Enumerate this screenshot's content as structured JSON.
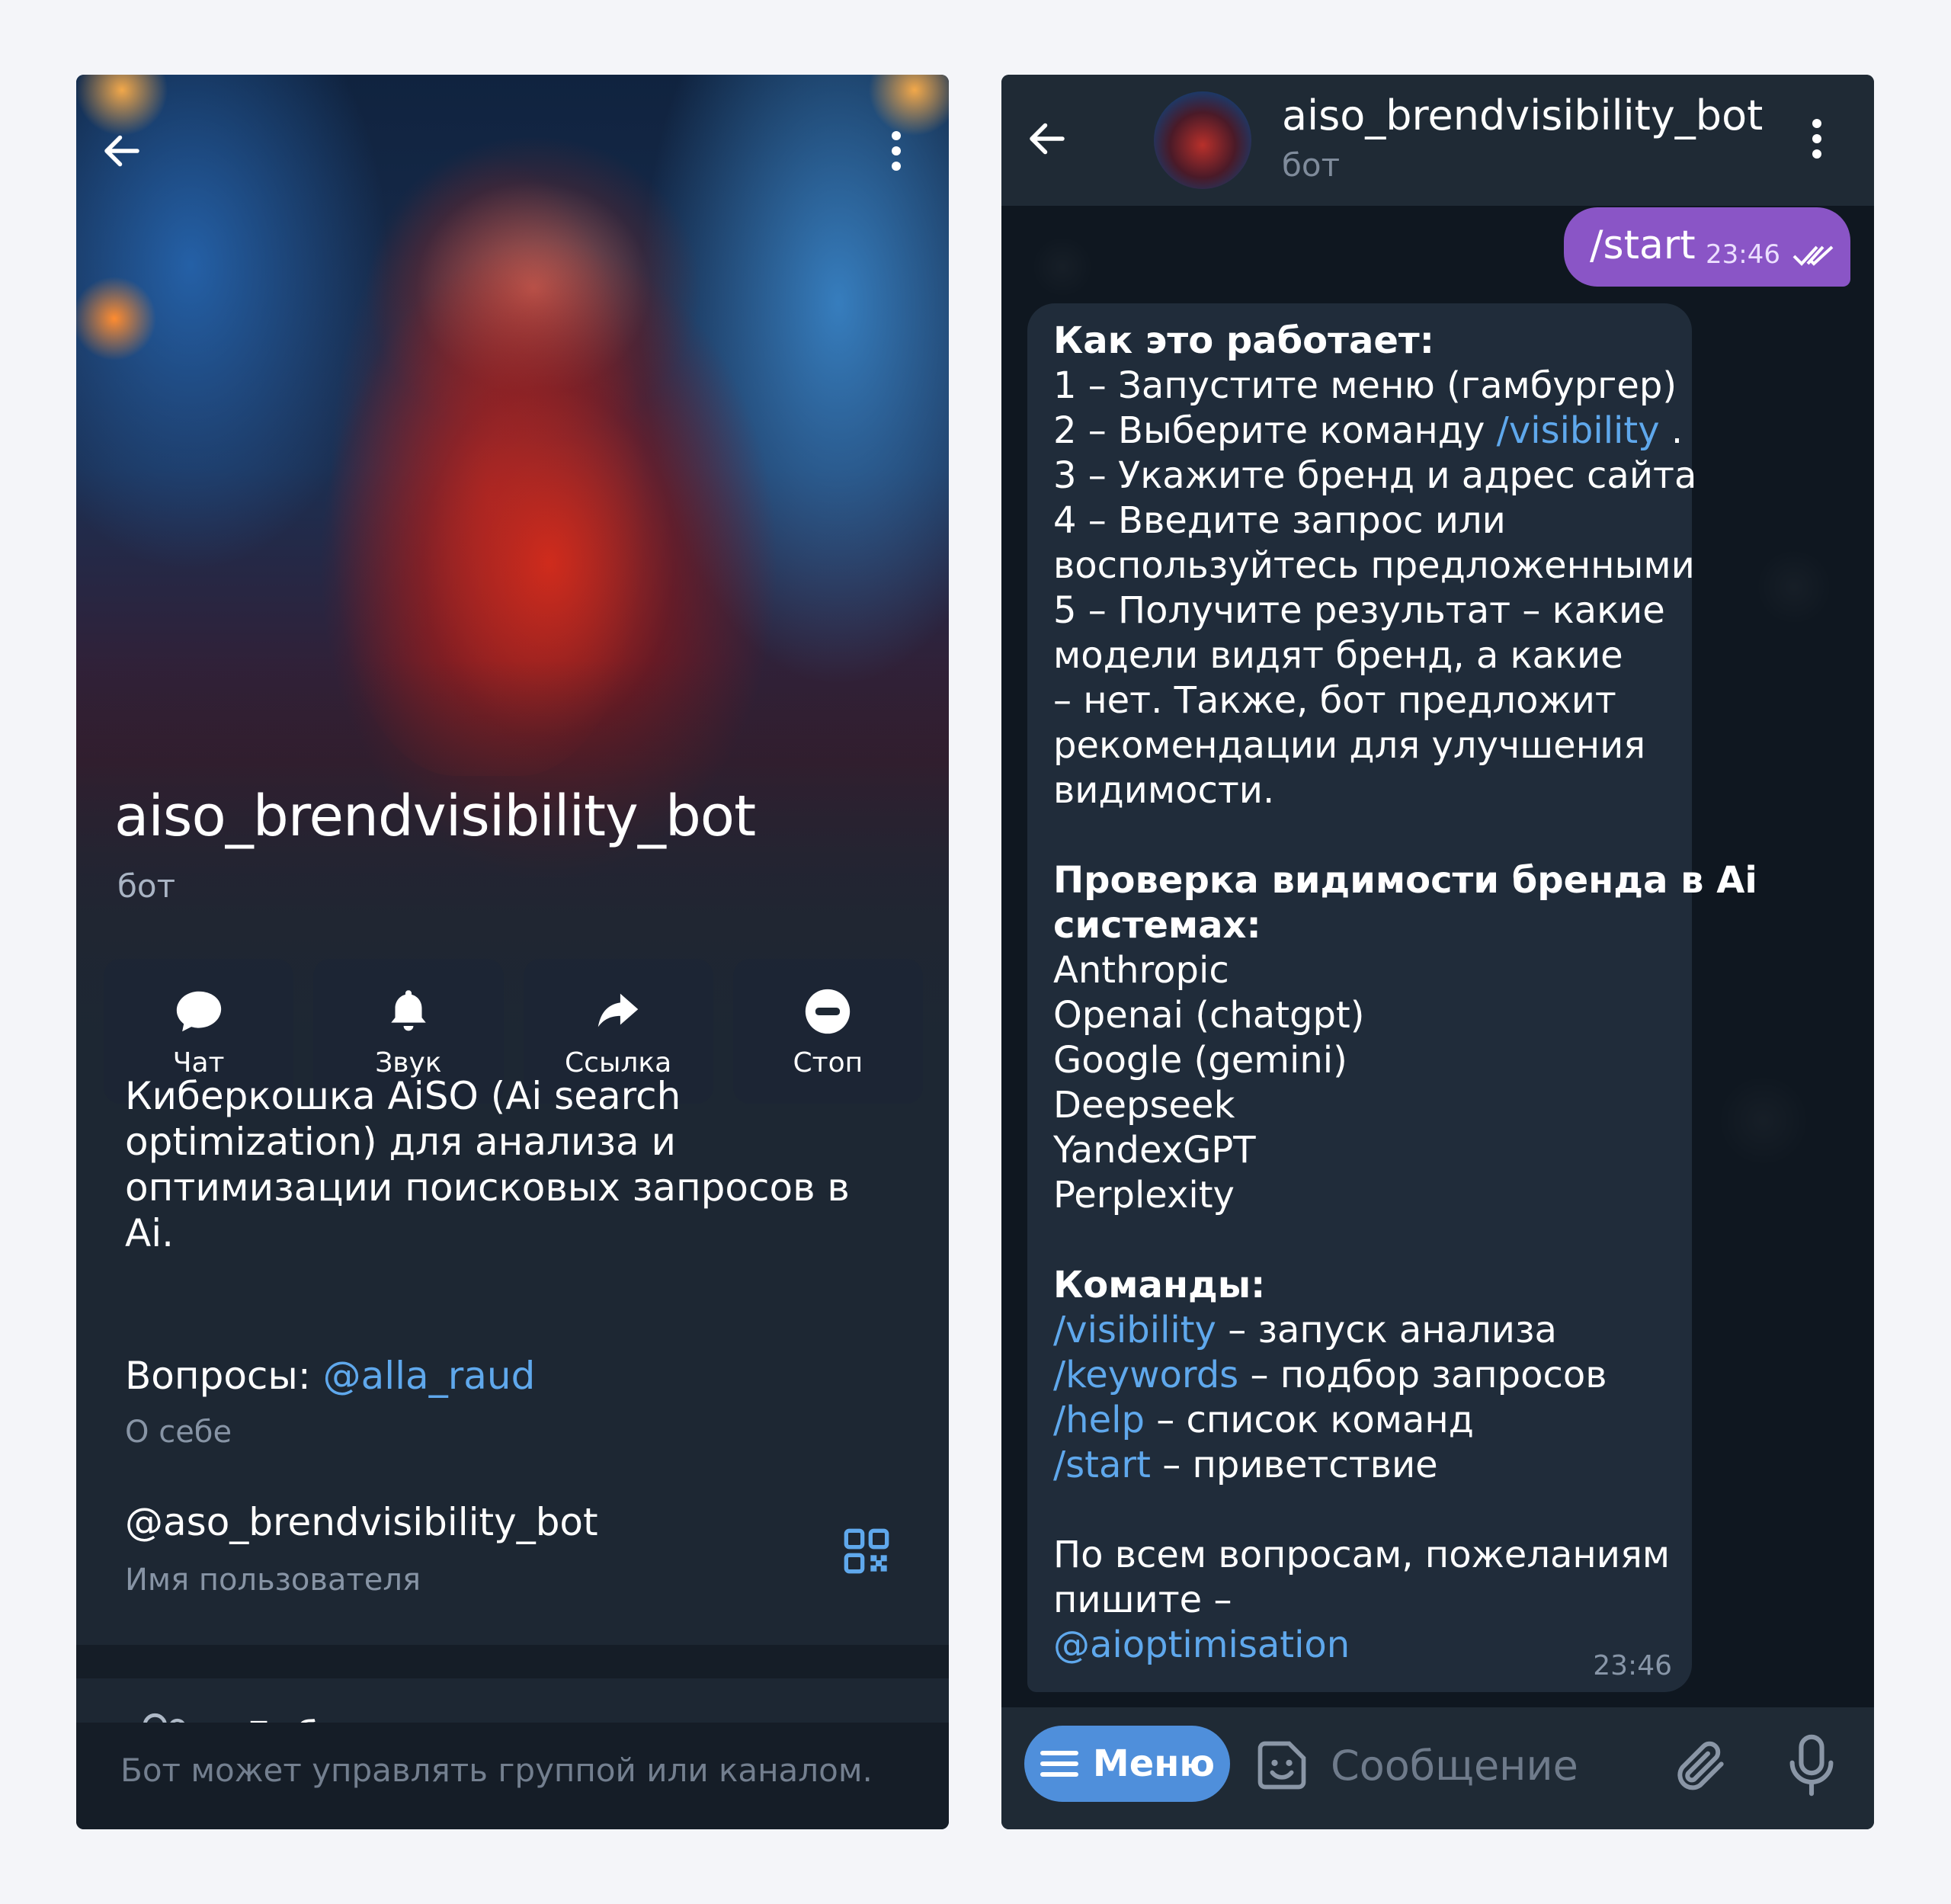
{
  "profile": {
    "name": "aiso_brendvisibility_bot",
    "subtitle": "бот",
    "actions": [
      {
        "label": "Чат",
        "icon": "chat-bubble-icon"
      },
      {
        "label": "Звук",
        "icon": "bell-icon"
      },
      {
        "label": "Ссылка",
        "icon": "share-arrow-icon"
      },
      {
        "label": "Стоп",
        "icon": "stop-icon"
      }
    ],
    "description": "Киберкошка AiSO (Ai search optimization) для анализа и оптимизации поисковых запросов в Ai.",
    "questions_prefix": "Вопросы: ",
    "questions_link": "@alla_raud",
    "about_label": "О себе",
    "username": "@aso_brendvisibility_bot",
    "username_label": "Имя пользователя",
    "add_to_group": "Добавить в группу или канал",
    "bot_note": "Бот может управлять группой или каналом."
  },
  "chat": {
    "title": "aiso_brendvisibility_bot",
    "subtitle": "бот",
    "outgoing": {
      "text": "/start",
      "time": "23:46"
    },
    "incoming": {
      "heading1": "Как это работает:",
      "steps": [
        "1 – Запустите меню (гамбургер)",
        "2 – Выберите команду ",
        "3 – Укажите бренд и адрес сайта",
        "4 – Введите запрос или",
        "воспользуйтесь предложенными",
        "5 – Получите результат – какие",
        "модели видят бренд, а какие",
        "– нет. Также, бот предложит",
        "рекомендации для улучшения",
        "видимости."
      ],
      "step2_link": "/visibility",
      "step2_tail": " .",
      "heading2_line1": "Проверка видимости бренда в Ai",
      "heading2_line2": "системах:",
      "systems": [
        "Anthropic",
        "Openai (chatgpt)",
        "Google (gemini)",
        "Deepseek",
        "YandexGPT",
        "Perplexity"
      ],
      "heading3": "Команды:",
      "commands": [
        {
          "cmd": "/visibility",
          "desc": " – запуск анализа"
        },
        {
          "cmd": "/keywords",
          "desc": " – подбор запросов"
        },
        {
          "cmd": "/help",
          "desc": " – список команд"
        },
        {
          "cmd": "/start",
          "desc": " – приветствие"
        }
      ],
      "footer_line1": "По всем вопросам, пожеланиям",
      "footer_line2": "пишите –",
      "footer_link": "@aioptimisation",
      "time": "23:46"
    },
    "input": {
      "menu_label": "Меню",
      "placeholder": "Сообщение"
    }
  },
  "colors": {
    "accent_link": "#5fa8ec",
    "outgoing_bubble": "#8a55c6",
    "menu_button": "#4f8fdb"
  }
}
